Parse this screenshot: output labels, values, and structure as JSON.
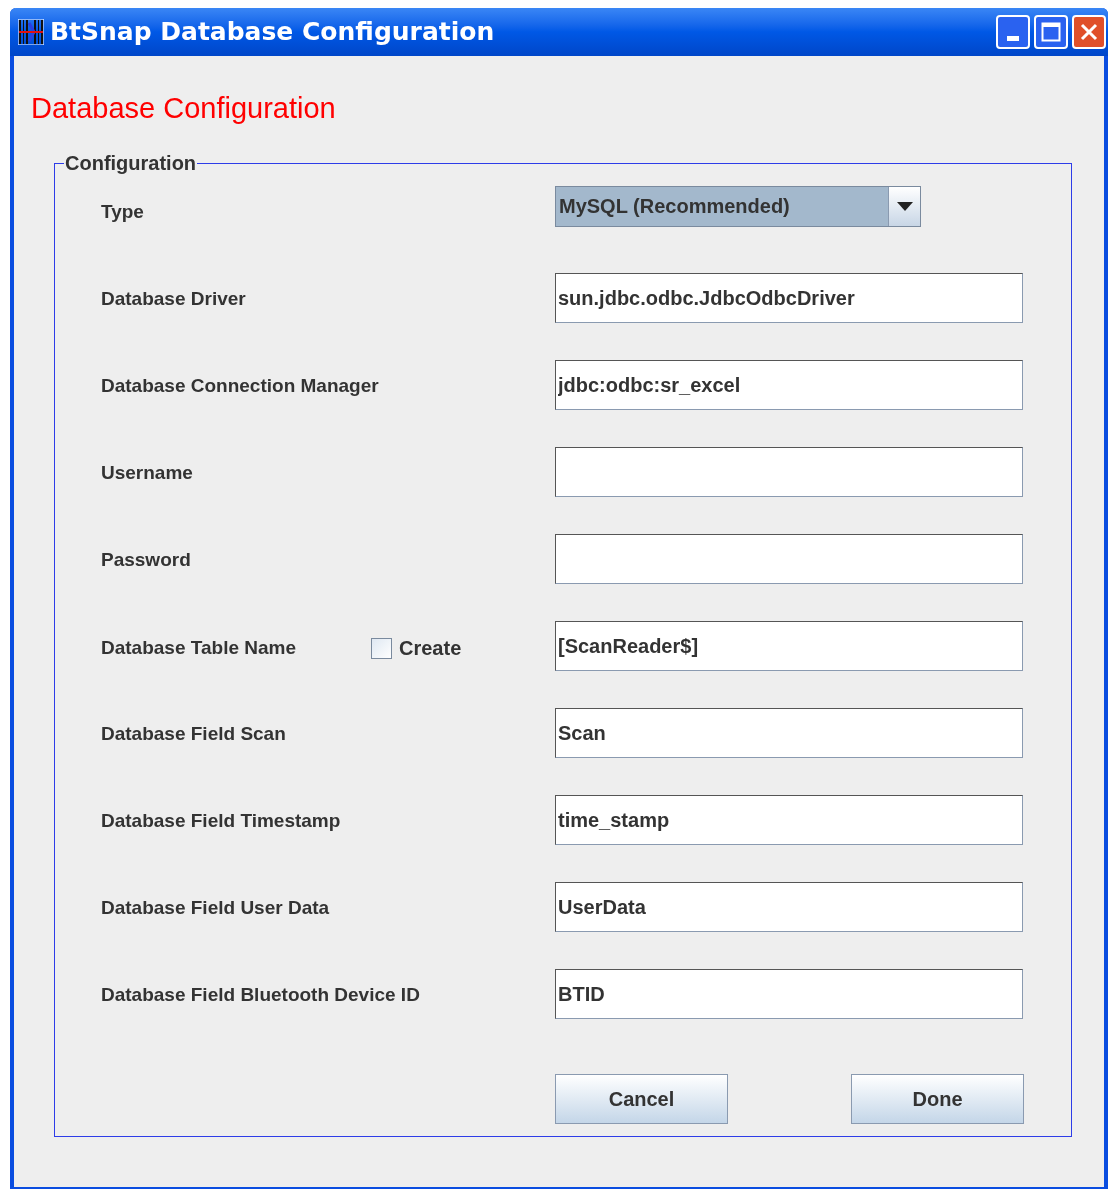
{
  "window": {
    "title": "BtSnap Database Configuration"
  },
  "heading": "Database Configuration",
  "group": {
    "title": "Configuration"
  },
  "rows": [
    {
      "kind": "select",
      "label": "Type",
      "value": "MySQL (Recommended)"
    },
    {
      "kind": "text",
      "label": "Database Driver",
      "value": "sun.jdbc.odbc.JdbcOdbcDriver"
    },
    {
      "kind": "text",
      "label": "Database Connection Manager",
      "value": "jdbc:odbc:sr_excel"
    },
    {
      "kind": "text",
      "label": "Username",
      "value": ""
    },
    {
      "kind": "text",
      "label": "Password",
      "value": ""
    },
    {
      "kind": "text_checkbox",
      "label": "Database Table Name",
      "value": "[ScanReader$]",
      "checkbox": {
        "label": "Create",
        "checked": false
      }
    },
    {
      "kind": "text",
      "label": "Database Field Scan",
      "value": "Scan"
    },
    {
      "kind": "text",
      "label": "Database Field Timestamp",
      "value": "time_stamp"
    },
    {
      "kind": "text",
      "label": "Database Field User Data",
      "value": "UserData"
    },
    {
      "kind": "text",
      "label": "Database Field Bluetooth Device ID",
      "value": "BTID"
    }
  ],
  "buttons": [
    "Cancel",
    "Done"
  ]
}
